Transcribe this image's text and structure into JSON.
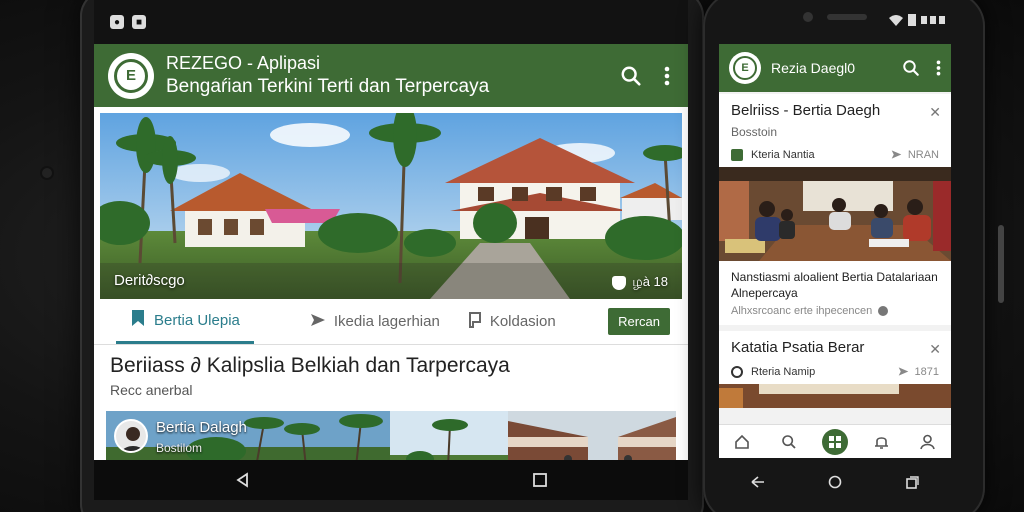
{
  "colors": {
    "brand_green": "#3e6b35",
    "accent_teal": "#2b7d8c"
  },
  "tablet": {
    "status_icons": [
      "status-icon-1",
      "status-icon-2"
    ],
    "app_title": "REZEGO - Aplipasi",
    "app_subtitle": "Bengaŕian Terkini Terti dan Terpercaya",
    "logo_text": "E",
    "hero_caption": "Derit∂scgo",
    "hero_badge": "ழà 18",
    "tabs": [
      {
        "label": "Bertia  Ulepia",
        "icon": "bookmark-icon"
      },
      {
        "label": "Ikedia lagerhian",
        "icon": "send-icon"
      },
      {
        "label": "Koldasion",
        "icon": "flag-icon"
      }
    ],
    "tab_button": "Rercan",
    "headline": "Beriiass ∂ Kalipslia Belkiah dan Tarpercaya",
    "kicker": "Recc anerbal",
    "strip_title": "Bertia Dalagh",
    "strip_subtitle": "Bostilom"
  },
  "phone": {
    "app_title": "Rezia Daegl0",
    "card1": {
      "title": "Belriiss  -  Bertia Daegh",
      "subtitle": "Bosstoin",
      "source": "Kteria Nantia",
      "meta": "NRAN",
      "article_title": "Nanstiasmi aloalient Bertia Datalariaan Alnepercaya",
      "article_meta": "Alhxsrcoanc erte ihpecencen"
    },
    "card2": {
      "title": "Katatia Psatia Berar",
      "source": "Rteria Namip",
      "meta": "1871"
    },
    "bottom_nav": [
      "home-icon",
      "search-icon",
      "apps-icon",
      "bell-icon",
      "profile-icon"
    ]
  }
}
